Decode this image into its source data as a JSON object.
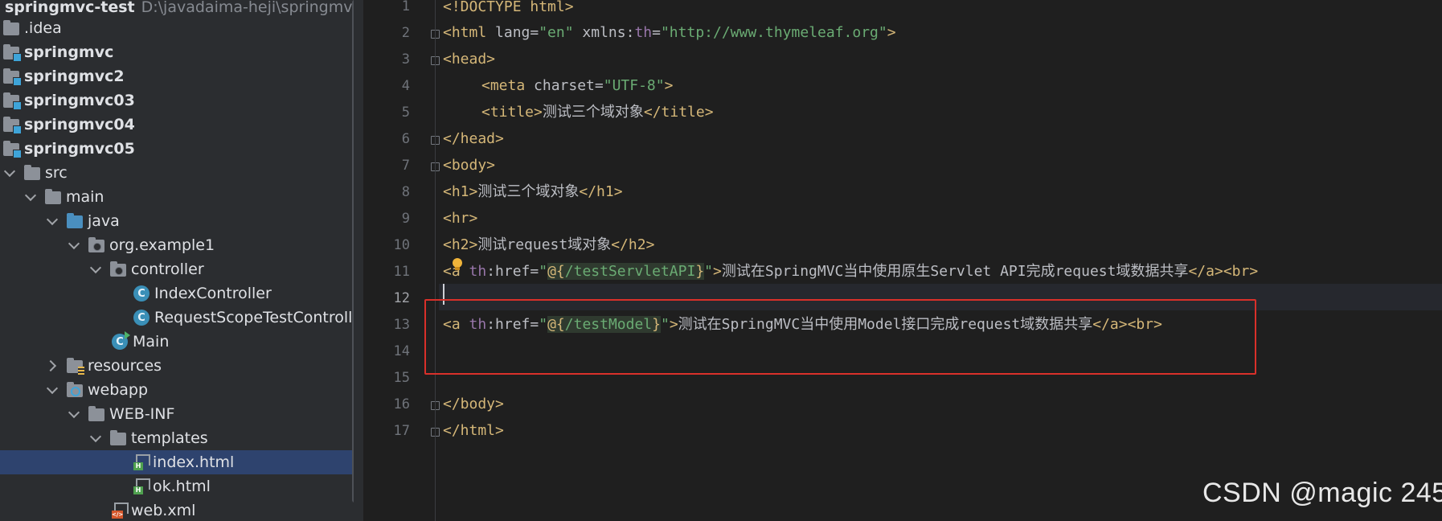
{
  "project": {
    "root_name": "springmvc-test",
    "root_path": "D:\\javadaima-heji\\springmvc-test",
    "items": [
      {
        "label": "springmvc-test"
      },
      {
        "label": ".idea"
      },
      {
        "label": "springmvc"
      },
      {
        "label": "springmvc2"
      },
      {
        "label": "springmvc03"
      },
      {
        "label": "springmvc04"
      },
      {
        "label": "springmvc05"
      },
      {
        "label": "src"
      },
      {
        "label": "main"
      },
      {
        "label": "java"
      },
      {
        "label": "org.example1"
      },
      {
        "label": "controller"
      },
      {
        "label": "IndexController"
      },
      {
        "label": "RequestScopeTestController"
      },
      {
        "label": "Main"
      },
      {
        "label": "resources"
      },
      {
        "label": "webapp"
      },
      {
        "label": "WEB-INF"
      },
      {
        "label": "templates"
      },
      {
        "label": "index.html"
      },
      {
        "label": "ok.html"
      },
      {
        "label": "web.xml"
      }
    ]
  },
  "editor": {
    "line_numbers": [
      "1",
      "2",
      "3",
      "4",
      "5",
      "6",
      "7",
      "8",
      "9",
      "10",
      "11",
      "12",
      "13",
      "14",
      "15",
      "16",
      "17"
    ],
    "current_line": "12",
    "code": {
      "l1_a": "<!DOCTYPE html>",
      "l2_open": "<html",
      "l2_attr": " lang=",
      "l2_lang": "\"en\"",
      "l2_xmlns": " xmlns:",
      "l2_th": "th",
      "l2_eq": "=",
      "l2_url": "\"http://www.thymeleaf.org\"",
      "l2_close": ">",
      "l3": "<head>",
      "l4_open": "<meta",
      "l4_attr": " charset=",
      "l4_val": "\"UTF-8\"",
      "l4_close": ">",
      "l5_open": "<title>",
      "l5_text": "测试三个域对象",
      "l5_close": "</title>",
      "l6": "</head>",
      "l7": "<body>",
      "l8_open": "<h1>",
      "l8_text": "测试三个域对象",
      "l8_close": "</h1>",
      "l9": "<hr>",
      "l10_open": "<h2>",
      "l10_text": "测试request域对象",
      "l10_close": "</h2>",
      "l11_open": "<a",
      "l11_ns": " th",
      "l11_attr": ":href=",
      "l11_q1": "\"",
      "l11_at": "@{",
      "l11_path": "/testServletAPI",
      "l11_br": "}",
      "l11_q2": "\"",
      "l11_gt": ">",
      "l11_text": "测试在SpringMVC当中使用原生Servlet API完成request域数据共享",
      "l11_close": "</a><br>",
      "l13_open": "<a",
      "l13_ns": " th",
      "l13_attr": ":href=",
      "l13_q1": "\"",
      "l13_at": "@{",
      "l13_path": "/testModel",
      "l13_br": "}",
      "l13_q2": "\"",
      "l13_gt": ">",
      "l13_text": "测试在SpringMVC当中使用Model接口完成request域数据共享",
      "l13_close": "</a><br>",
      "l16": "</body>",
      "l17": "</html>"
    }
  },
  "watermark": "CSDN @magic 245",
  "colors": {
    "highlight_box": "#d9302a",
    "tag": "#d5b778",
    "string": "#6aab73",
    "namespace": "#9876aa",
    "selection": "#2e436e"
  }
}
